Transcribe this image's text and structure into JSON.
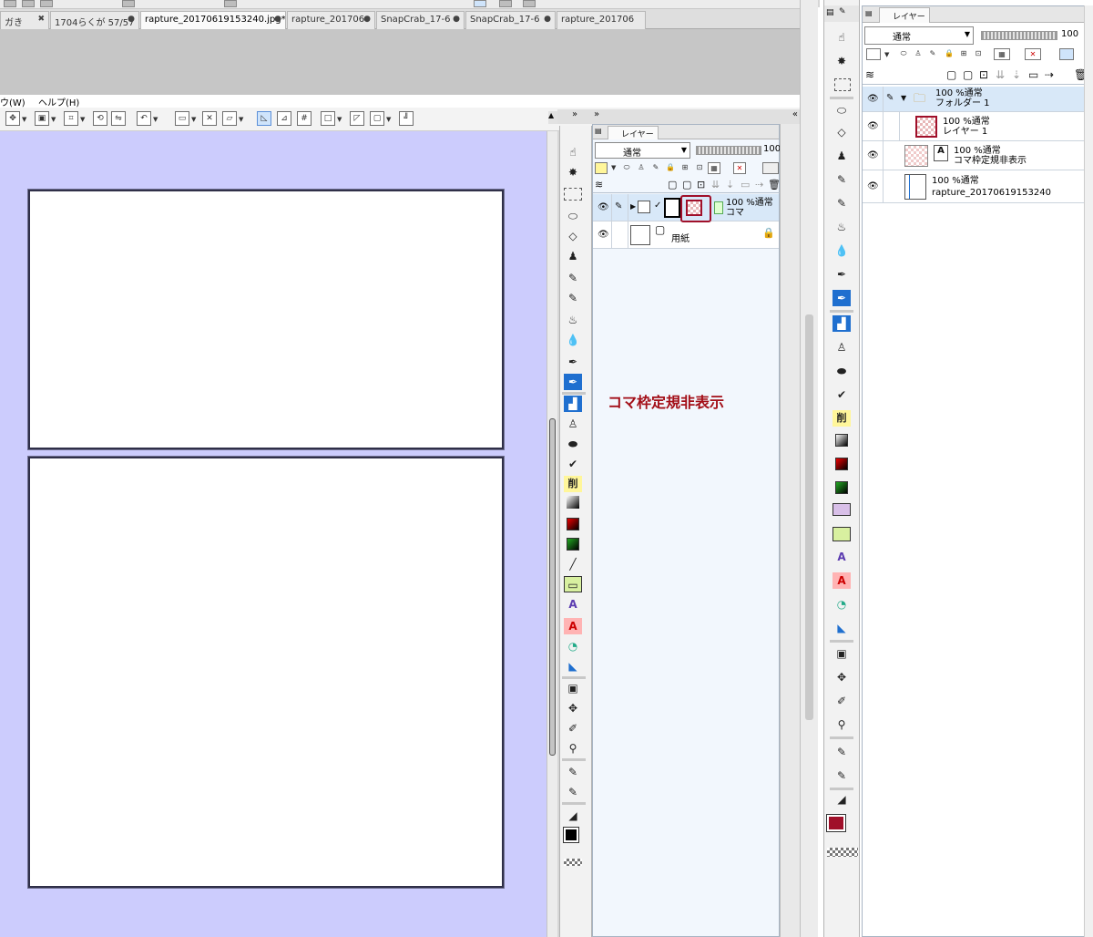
{
  "menu": {
    "window_label": "ウ(W)",
    "help_label": "ヘルプ(H)"
  },
  "tabs": [
    {
      "label": "ガき",
      "close": "✖"
    },
    {
      "label": "1704らくが  57/57",
      "close": "●"
    },
    {
      "label": "rapture_20170619153240.jpg*",
      "close": "●"
    },
    {
      "label": "rapture_201706",
      "close": "●"
    },
    {
      "label": "SnapCrab_17-6",
      "close": "●"
    },
    {
      "label": "SnapCrab_17-6",
      "close": "●"
    },
    {
      "label": "rapture_201706",
      "close": ""
    }
  ],
  "layer_panel_left": {
    "tab_label": "レイヤー",
    "blend_mode": "通常",
    "opacity": "100",
    "layers": [
      {
        "opacity_mode": "100 %通常",
        "name": "コマ",
        "selected": true
      },
      {
        "name": "用紙",
        "locked": true
      }
    ]
  },
  "annotation": "コマ枠定規非表示",
  "layer_panel_right": {
    "tab_label": "レイヤー",
    "blend_mode": "通常",
    "opacity": "100",
    "layers": [
      {
        "opacity_mode": "100 %通常",
        "name": "フォルダー 1",
        "type": "folder"
      },
      {
        "opacity_mode": "100 %通常",
        "name": "レイヤー 1",
        "type": "raster"
      },
      {
        "opacity_mode": "100 %通常",
        "name": "コマ枠定規非表示",
        "type": "text"
      },
      {
        "opacity_mode": "100 %通常",
        "name": "rapture_20170619153240",
        "type": "image"
      }
    ]
  },
  "tools": {
    "text_label": "削",
    "text_a": "A"
  },
  "colors": {
    "accent": "#a30f18",
    "canvas_bg": "#ccccfd",
    "main_color_left": "#000000",
    "main_color_right": "#a0102a",
    "sub_color": "#a8cef7"
  }
}
